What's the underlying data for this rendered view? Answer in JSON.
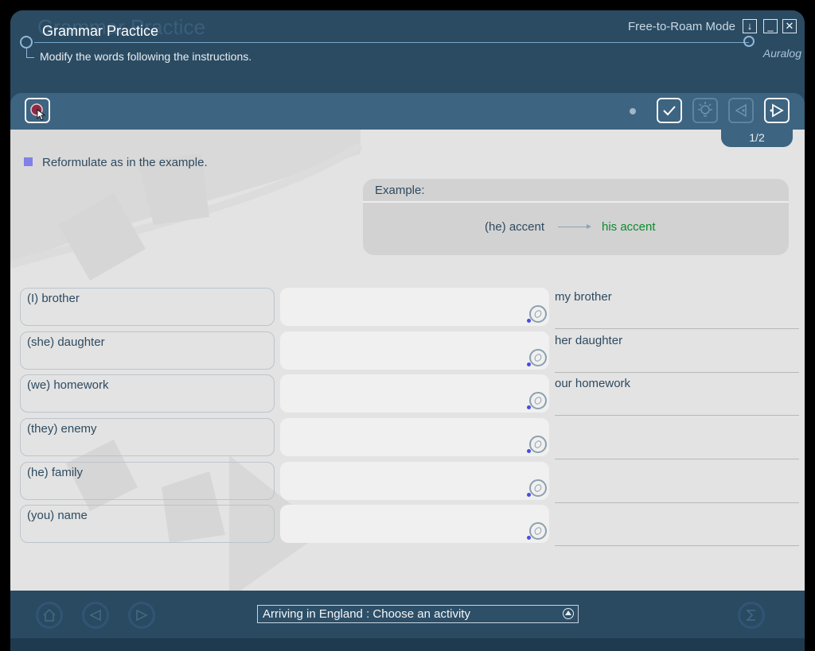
{
  "header": {
    "title": "Grammar Practice",
    "subtitle": "Modify the words following the instructions.",
    "mode": "Free-to-Roam Mode",
    "brand": "Auralog",
    "window_buttons": [
      "↓",
      "_",
      "✕"
    ]
  },
  "toolbar": {
    "record_icon": "record-icon",
    "check_icon": "check-icon",
    "hint_icon": "lightbulb-icon",
    "prev_icon": "previous-icon",
    "next_icon": "next-icon",
    "page": "1/2"
  },
  "exercise": {
    "instruction": "Reformulate as in the example.",
    "example": {
      "label": "Example:",
      "question": "(he) accent",
      "answer": "his accent"
    },
    "rows": [
      {
        "prompt": "(I) brother",
        "answer": "",
        "solution": "my brother"
      },
      {
        "prompt": "(she) daughter",
        "answer": "",
        "solution": "her daughter"
      },
      {
        "prompt": "(we) homework",
        "answer": "",
        "solution": "our homework"
      },
      {
        "prompt": "(they) enemy",
        "answer": "",
        "solution": ""
      },
      {
        "prompt": "(he) family",
        "answer": "",
        "solution": ""
      },
      {
        "prompt": "(you) name",
        "answer": "",
        "solution": ""
      }
    ]
  },
  "footer": {
    "activity": "Arriving in England : Choose an activity",
    "icons": [
      "home-icon",
      "previous-icon",
      "next-icon",
      "summary-icon"
    ]
  },
  "colors": {
    "frame": "#2b4b63",
    "toolbar": "#3d6480",
    "content": "#e3e3e3",
    "correct": "#0d8a2e",
    "accent": "#8080e8"
  }
}
